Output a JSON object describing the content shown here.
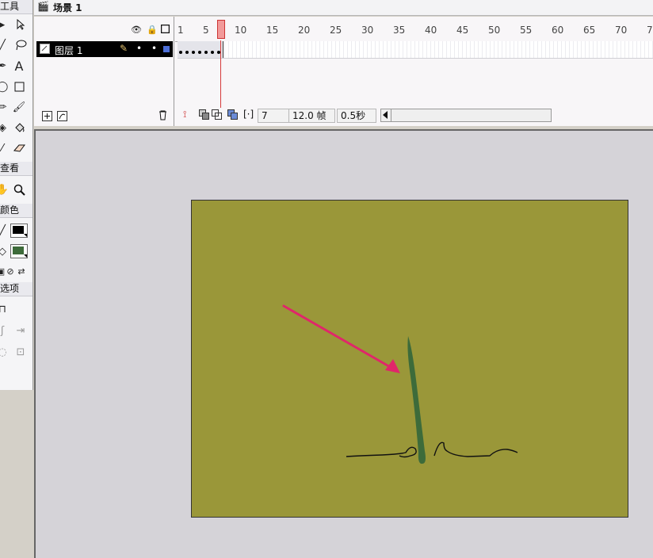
{
  "tools_panel": {
    "sections": [
      {
        "title": "工具"
      },
      {
        "title": "查看"
      },
      {
        "title": "颜色"
      },
      {
        "title": "选项"
      }
    ],
    "text_tool_glyph": "A",
    "stroke_color": "#000000",
    "fill_color": "#3d6b3a"
  },
  "scene": {
    "label": "场景 1"
  },
  "timeline": {
    "layers": [
      {
        "name": "图层 1"
      }
    ],
    "ruler_ticks": [
      "1",
      "5",
      "10",
      "15",
      "20",
      "25",
      "30",
      "35",
      "40",
      "45",
      "50",
      "55",
      "60",
      "65",
      "70",
      "7"
    ],
    "current_frame": "7",
    "frame_rate": "12.0 帧",
    "elapsed_time": "0.5秒",
    "keyframe_count": 7
  },
  "stage": {
    "background_color": "#9a9739",
    "grass_color": "#3d6b3a",
    "arrow_color": "#e0266a"
  }
}
